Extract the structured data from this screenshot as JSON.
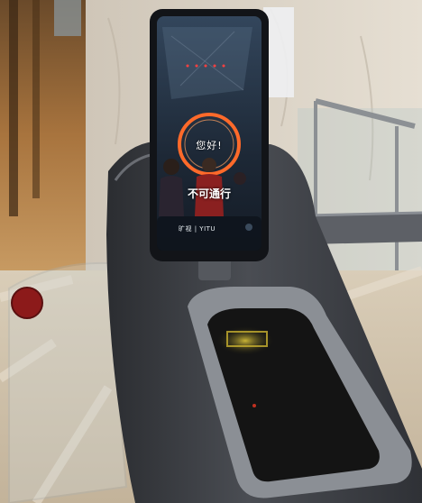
{
  "screen": {
    "greeting": "您好!",
    "status": "不可通行",
    "brand": "旷视 | YITU"
  },
  "colors": {
    "ring": "#ff6a2a",
    "screen_bg": "#1e2a3a",
    "scanner_glow": "#d8c23a"
  }
}
